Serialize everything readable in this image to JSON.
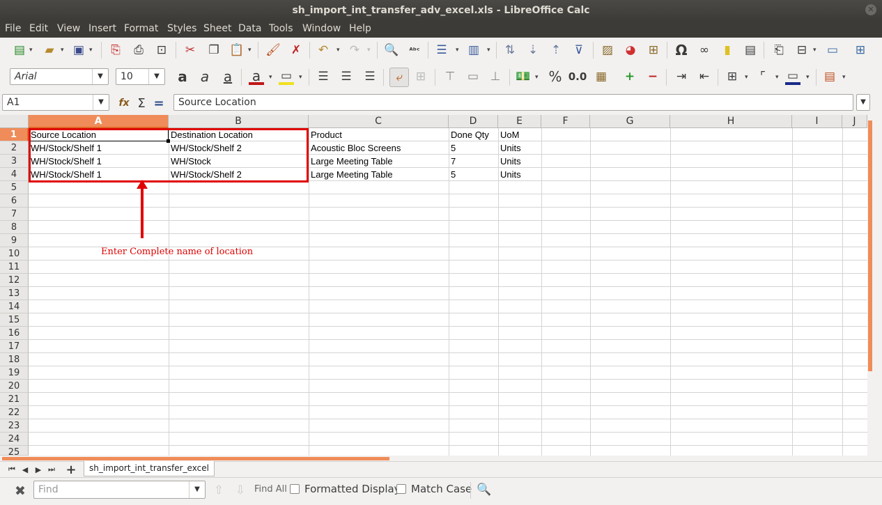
{
  "window": {
    "title": "sh_import_int_transfer_adv_excel.xls - LibreOffice Calc",
    "close_icon": "✕"
  },
  "menu": [
    "File",
    "Edit",
    "View",
    "Insert",
    "Format",
    "Styles",
    "Sheet",
    "Data",
    "Tools",
    "Window",
    "Help"
  ],
  "formatting": {
    "font_name": "Arial",
    "font_size": "10",
    "percent": "%",
    "decimal": "0.0"
  },
  "formula_bar": {
    "cell_ref": "A1",
    "content": "Source Location",
    "sigma": "Σ",
    "equals": "="
  },
  "columns": [
    "A",
    "B",
    "C",
    "D",
    "E",
    "F",
    "G",
    "H",
    "I",
    "J"
  ],
  "rows": [
    "1",
    "2",
    "3",
    "4",
    "5",
    "6",
    "7",
    "8",
    "9",
    "10",
    "11",
    "12",
    "13",
    "14",
    "15",
    "16",
    "17",
    "18",
    "19",
    "20",
    "21",
    "22",
    "23",
    "24",
    "25"
  ],
  "cells": [
    [
      "Source Location",
      "Destination Location",
      "Product",
      "Done Qty",
      "UoM"
    ],
    [
      "WH/Stock/Shelf 1",
      "WH/Stock/Shelf 2",
      "Acoustic Bloc Screens",
      "5",
      "Units"
    ],
    [
      "WH/Stock/Shelf 1",
      "WH/Stock",
      "Large Meeting Table",
      "7",
      "Units"
    ],
    [
      "WH/Stock/Shelf 1",
      "WH/Stock/Shelf 2",
      "Large Meeting Table",
      "5",
      "Units"
    ]
  ],
  "annotation": {
    "text": "Enter Complete name of location",
    "color": "#e00000"
  },
  "sheet_tab": "sh_import_int_transfer_excel",
  "find_bar": {
    "placeholder": "Find",
    "find_all": "Find All",
    "formatted_display": "Formatted Display",
    "match_case": "Match Case"
  },
  "accent_color": "#f08c59"
}
